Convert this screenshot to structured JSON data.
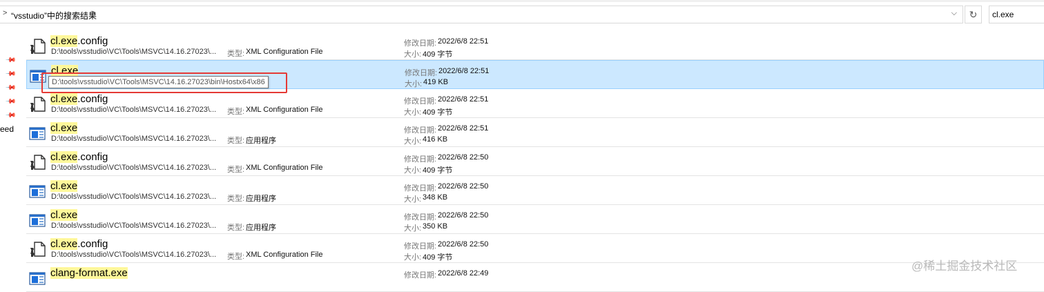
{
  "address_bar": {
    "text": "“vsstudio”中的搜索结果",
    "chevron": ">",
    "separator": ">",
    "dropdown": "⌵"
  },
  "refresh": {
    "icon": "refresh-icon",
    "glyph": "↻"
  },
  "search": {
    "value": "cl.exe"
  },
  "nav": {
    "partial_label": "eed",
    "pin_glyph": "📌"
  },
  "tooltip": "D:\\tools\\vsstudio\\VC\\Tools\\MSVC\\14.16.27023\\bin\\Hostx64\\x86",
  "labels": {
    "type": "类型:",
    "modified": "修改日期:",
    "size": "大小:"
  },
  "accent": {
    "selection_bg": "#cce8ff",
    "highlight": "#fff89a",
    "red_box": "#e53935"
  },
  "items": [
    {
      "hl": "cl.exe",
      "rest": ".config",
      "path": "D:\\tools\\vsstudio\\VC\\Tools\\MSVC\\14.16.27023\\...",
      "type": "XML Configuration File",
      "date": "2022/6/8 22:51",
      "size": "409 字节",
      "icon": "config-file-icon"
    },
    {
      "hl": "cl.exe",
      "rest": "",
      "path": "",
      "type": "",
      "date": "2022/6/8 22:51",
      "size": "419 KB",
      "icon": "application-icon",
      "selected": true
    },
    {
      "hl": "cl.exe",
      "rest": ".config",
      "path": "D:\\tools\\vsstudio\\VC\\Tools\\MSVC\\14.16.27023\\...",
      "type": "XML Configuration File",
      "date": "2022/6/8 22:51",
      "size": "409 字节",
      "icon": "config-file-icon"
    },
    {
      "hl": "cl.exe",
      "rest": "",
      "path": "D:\\tools\\vsstudio\\VC\\Tools\\MSVC\\14.16.27023\\...",
      "type": "应用程序",
      "date": "2022/6/8 22:51",
      "size": "416 KB",
      "icon": "application-icon"
    },
    {
      "hl": "cl.exe",
      "rest": ".config",
      "path": "D:\\tools\\vsstudio\\VC\\Tools\\MSVC\\14.16.27023\\...",
      "type": "XML Configuration File",
      "date": "2022/6/8 22:50",
      "size": "409 字节",
      "icon": "config-file-icon"
    },
    {
      "hl": "cl.exe",
      "rest": "",
      "path": "D:\\tools\\vsstudio\\VC\\Tools\\MSVC\\14.16.27023\\...",
      "type": "应用程序",
      "date": "2022/6/8 22:50",
      "size": "348 KB",
      "icon": "application-icon"
    },
    {
      "hl": "cl.exe",
      "rest": "",
      "path": "D:\\tools\\vsstudio\\VC\\Tools\\MSVC\\14.16.27023\\...",
      "type": "应用程序",
      "date": "2022/6/8 22:50",
      "size": "350 KB",
      "icon": "application-icon"
    },
    {
      "hl": "cl.exe",
      "rest": ".config",
      "path": "D:\\tools\\vsstudio\\VC\\Tools\\MSVC\\14.16.27023\\...",
      "type": "XML Configuration File",
      "date": "2022/6/8 22:50",
      "size": "409 字节",
      "icon": "config-file-icon"
    },
    {
      "hl": "clang-format.exe",
      "rest": "",
      "path": "",
      "type": "",
      "date": "2022/6/8 22:49",
      "size": "",
      "icon": "application-icon"
    }
  ],
  "watermark": "@稀土掘金技术社区"
}
